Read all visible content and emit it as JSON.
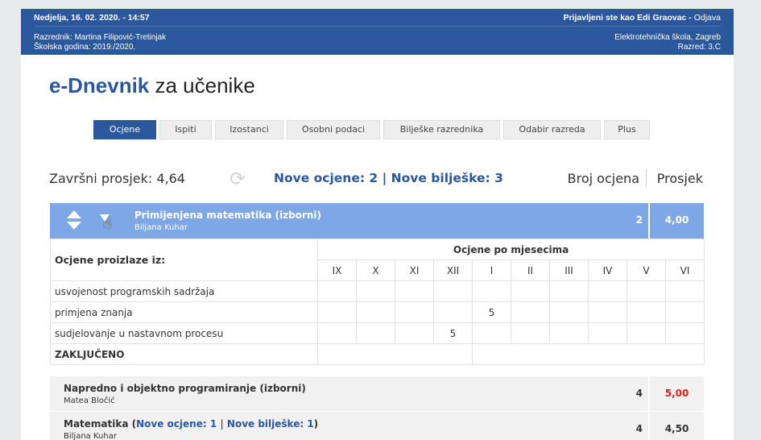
{
  "topbar": {
    "date_time": "Nedjelja, 16. 02. 2020. - 14:57",
    "logged_in_as": "Prijavljeni ste kao Edi Graovac",
    "dash": " - ",
    "logout": "Odjava",
    "class_teacher": "Razrednik: Martina Filipović-Tretinjak",
    "school_year": "Školska godina: 2019./2020.",
    "school": "Elektrotehnička škola, Zagreb",
    "class": "Razred: 3.C"
  },
  "app": {
    "brand": "e-Dnevnik",
    "subtitle": " za učenike"
  },
  "tabs": [
    "Ocjene",
    "Ispiti",
    "Izostanci",
    "Osobni podaci",
    "Bilješke razrednika",
    "Odabir razreda",
    "Plus"
  ],
  "summary": {
    "final_average": "Završni prosjek: 4,64",
    "new_grades": "Nove ocjene: 2 | Nove bilješke: 3",
    "col_count": "Broj ocjena",
    "col_avg": "Prosjek"
  },
  "subjects": [
    {
      "name": "Primijenjena matematika (izborni)",
      "teacher": "Biljana Kuhar",
      "count": "2",
      "average": "4,00"
    },
    {
      "name": "Napredno i objektno programiranje (izborni)",
      "teacher": "Matea Bločić",
      "count": "4",
      "average": "5,00",
      "average_color": "#d91f1f"
    },
    {
      "name": "Matematika",
      "name_open": " (",
      "new_info": "Nove ocjene: 1 | Nove bilješke: 1",
      "name_close": ")",
      "teacher": "Biljana Kuhar",
      "count": "4",
      "average": "4,50"
    }
  ],
  "grade_table": {
    "left_header": "Ocjene proizlaze iz:",
    "months_header": "Ocjene po mjesecima",
    "months": [
      "IX",
      "X",
      "XI",
      "XII",
      "I",
      "II",
      "III",
      "IV",
      "V",
      "VI"
    ],
    "rows": [
      {
        "label": "usvojenost programskih sadržaja",
        "grades": [
          "",
          "",
          "",
          "",
          "",
          "",
          "",
          "",
          "",
          ""
        ]
      },
      {
        "label": "primjena znanja",
        "grades": [
          "",
          "",
          "",
          "",
          "5",
          "",
          "",
          "",
          "",
          ""
        ]
      },
      {
        "label": "sudjelovanje u nastavnom procesu",
        "grades": [
          "",
          "",
          "",
          "5",
          "",
          "",
          "",
          "",
          "",
          ""
        ]
      }
    ],
    "final_label": "ZAKLJUČENO"
  },
  "colors": {
    "primary": "#2b579d",
    "expanded_row": "#7ea7e6",
    "average_red": "#d91f1f"
  }
}
